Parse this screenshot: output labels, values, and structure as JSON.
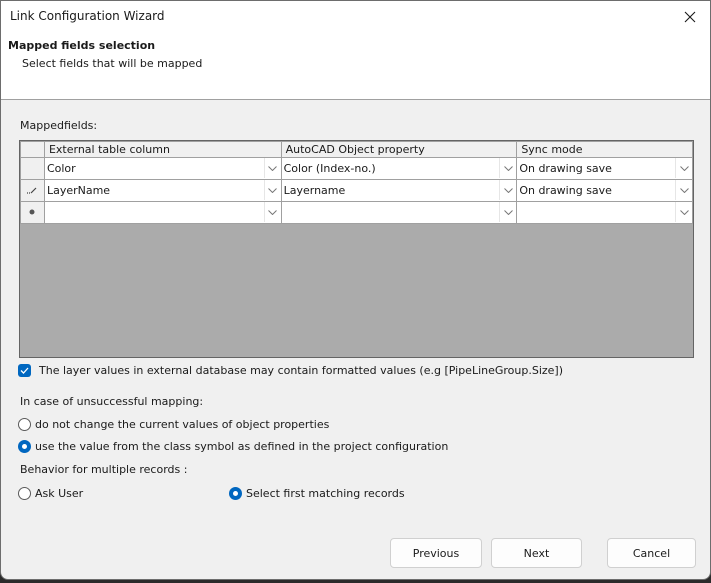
{
  "window": {
    "title": "Link Configuration Wizard"
  },
  "header": {
    "title": "Mapped fields selection",
    "subtitle": "Select fields that will be mapped"
  },
  "mapped_fields": {
    "label": "Mappedfields:",
    "columns": [
      "External table column",
      "AutoCAD Object property",
      "Sync mode"
    ],
    "rows": [
      {
        "indicator": "",
        "external": "Color",
        "property": "Color (Index-no.)",
        "sync": "On drawing save"
      },
      {
        "indicator": "edit",
        "external": "LayerName",
        "property": "Layername",
        "sync": "On drawing save"
      },
      {
        "indicator": "new",
        "external": "",
        "property": "",
        "sync": ""
      }
    ]
  },
  "formatted_values_checkbox": {
    "label": "The layer values in external database may contain formatted values (e.g [PipeLineGroup.Size])",
    "checked": true
  },
  "unsuccessful_mapping": {
    "label": "In case of unsuccessful mapping:",
    "options": [
      {
        "label": "do not change the current values of object properties",
        "selected": false
      },
      {
        "label": "use the value from the class symbol as defined in the project configuration",
        "selected": true
      }
    ]
  },
  "multiple_records": {
    "label": "Behavior for multiple records :",
    "options": [
      {
        "label": "Ask User",
        "selected": false
      },
      {
        "label": "Select first matching records",
        "selected": true
      }
    ]
  },
  "buttons": {
    "previous": "Previous",
    "next": "Next",
    "cancel": "Cancel"
  },
  "colors": {
    "accent": "#0067c0",
    "grid_empty": "#ababab"
  }
}
